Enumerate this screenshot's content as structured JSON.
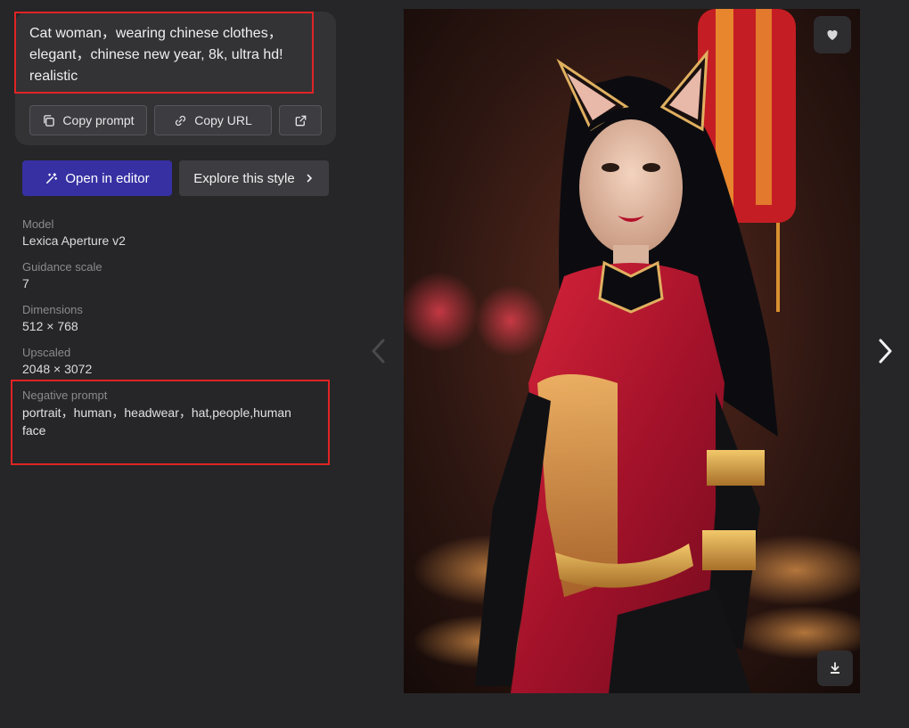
{
  "prompt": {
    "text": "Cat woman，wearing chinese clothes，elegant，chinese new year, 8k, ultra hd! realistic",
    "copy_prompt_label": "Copy prompt",
    "copy_url_label": "Copy URL"
  },
  "actions": {
    "open_editor_label": "Open in editor",
    "explore_style_label": "Explore this style"
  },
  "meta": {
    "model_label": "Model",
    "model_value": "Lexica Aperture v2",
    "guidance_label": "Guidance scale",
    "guidance_value": "7",
    "dimensions_label": "Dimensions",
    "dimensions_value": "512 × 768",
    "upscaled_label": "Upscaled",
    "upscaled_value": "2048 × 3072",
    "negative_label": "Negative prompt",
    "negative_value": "portrait，human，headwear，hat,people,human face"
  },
  "colors": {
    "background": "#262628",
    "card": "#333336",
    "primary_button": "#3730a3",
    "highlight_border": "#e02424"
  },
  "icons": {
    "copy": "copy-icon",
    "link": "link-icon",
    "external": "external-link-icon",
    "wand": "magic-wand-icon",
    "chevron": "chevron-right-icon",
    "heart": "heart-icon",
    "download": "download-icon",
    "prev": "chevron-left-icon",
    "next": "chevron-right-icon"
  }
}
